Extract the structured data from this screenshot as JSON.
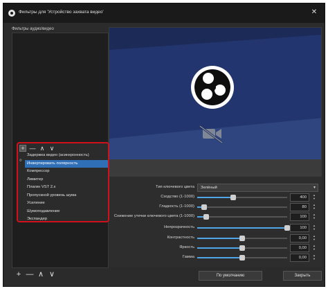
{
  "window": {
    "title": "Фильтры для 'Устройство захвата видео'",
    "close_glyph": "✕"
  },
  "left_panel": {
    "label": "Фильтры аудио/видео",
    "controls": {
      "add": "+",
      "remove": "—",
      "up": "∧",
      "down": "∨"
    }
  },
  "context_menu": {
    "items": [
      "Задержка видео (асинхронность)",
      "Инвертировать полярность",
      "Компрессор",
      "Лимитер",
      "Плагин VST 2.x",
      "Пропускной уровень шума",
      "Усиление",
      "Шумоподавление",
      "Экспандер"
    ],
    "selected_index": 1,
    "edge_glyph": "Ф"
  },
  "settings": {
    "key_color_type": {
      "label": "Тип ключевого цвета",
      "value": "Зелёный",
      "arrow": "▾"
    },
    "sliders": [
      {
        "label": "Сходство (1-1000)",
        "value": "400",
        "fraction": 0.4
      },
      {
        "label": "Гладкость (1-1000)",
        "value": "80",
        "fraction": 0.08
      },
      {
        "label": "Снижение утечки ключевого цвета (1-1000)",
        "value": "100",
        "fraction": 0.1
      },
      {
        "label": "Непрозрачность",
        "value": "100",
        "fraction": 1.0
      },
      {
        "label": "Контрастность",
        "value": "0,00",
        "fraction": 0.5
      },
      {
        "label": "Яркость",
        "value": "0,00",
        "fraction": 0.5
      },
      {
        "label": "Гамма",
        "value": "0,00",
        "fraction": 0.5
      }
    ],
    "spin_up": "▲",
    "spin_down": "▼"
  },
  "footer": {
    "defaults_label": "По умолчанию",
    "close_label": "Закрыть"
  },
  "colors": {
    "accent": "#4fa7e8",
    "selection": "#2f6fb6",
    "highlight_frame": "#d0101a"
  }
}
